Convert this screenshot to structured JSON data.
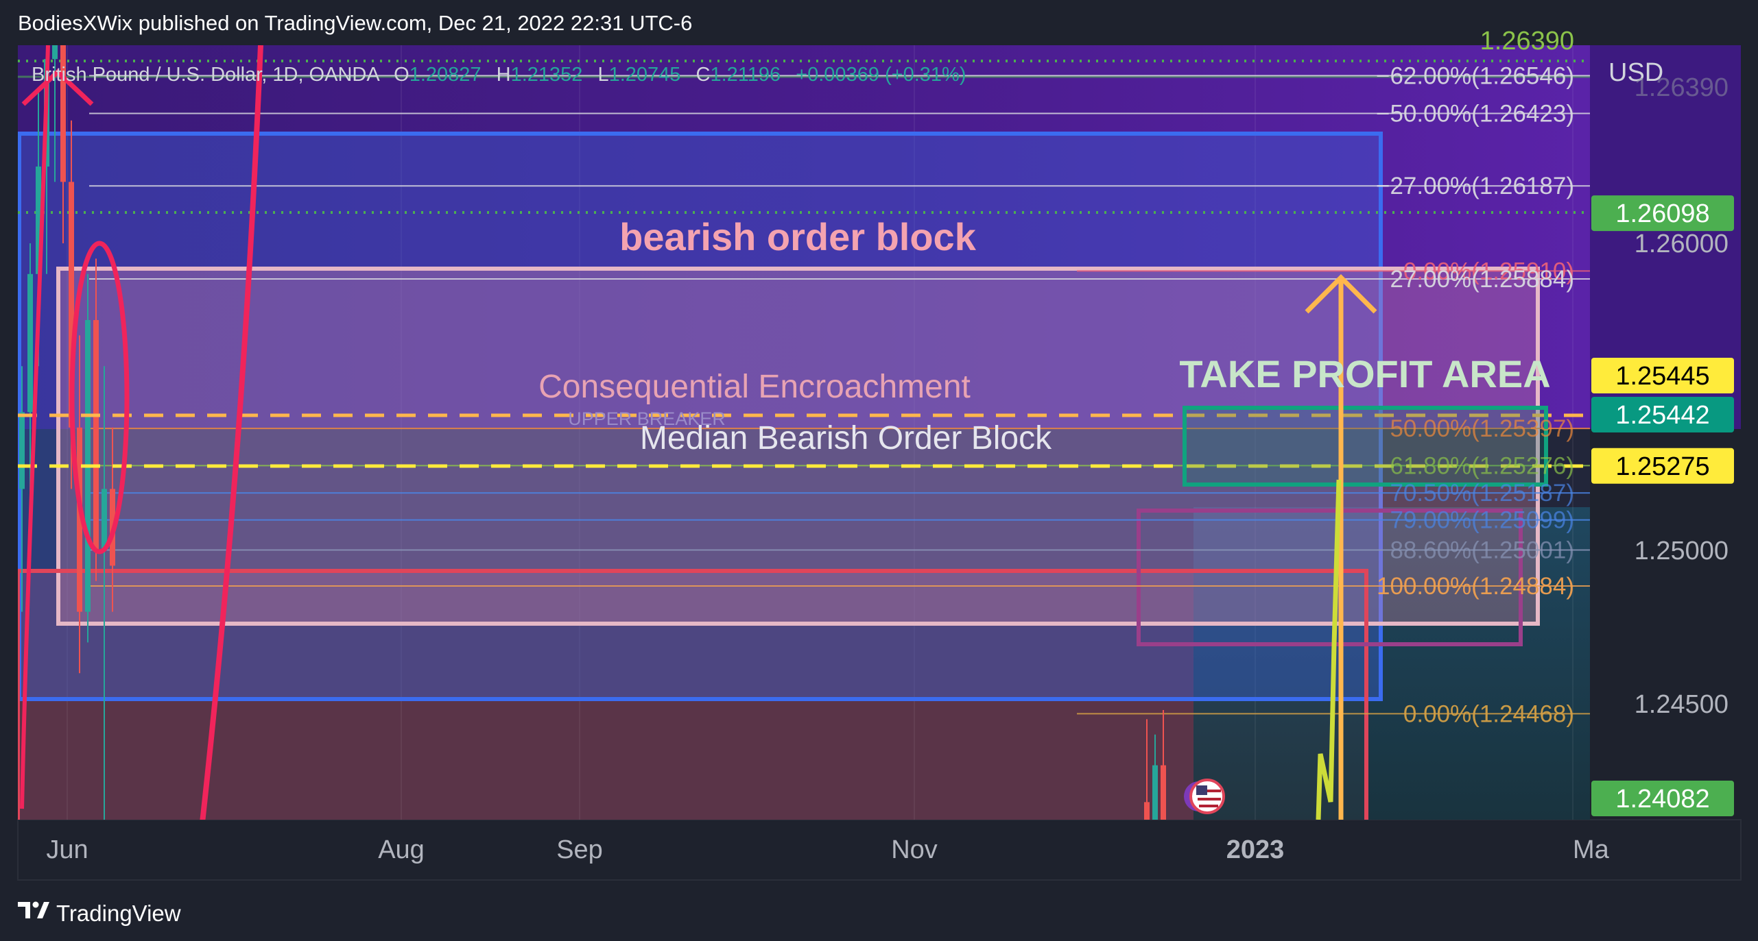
{
  "header": {
    "publish_line": "BodiesXWix published on TradingView.com, Dec 21, 2022 22:31 UTC-6"
  },
  "footer": {
    "brand": "TradingView"
  },
  "symbol": {
    "name": "British Pound / U.S. Dollar, 1D, OANDA",
    "o_label": "O",
    "o": "1.20827",
    "h_label": "H",
    "h": "1.21352",
    "l_label": "L",
    "l": "1.20745",
    "c_label": "C",
    "c": "1.21196",
    "change": "+0.00369 (+0.31%)"
  },
  "colors": {
    "background": "#1e222d",
    "purple_zone": "#5a1f9a",
    "blue_box": "#2f55c9",
    "order_block": "#c77a9b",
    "green_badge": "#4caf50",
    "yellow_badge": "#ffeb3b",
    "teal_badge": "#089981",
    "orange_dash": "#ffb74d",
    "tp_box": "#10a37f",
    "red_circle": "#f0245b"
  },
  "chart_data": {
    "type": "candlestick",
    "price_axis_unit": "USD",
    "y_range": [
      1.238,
      1.273
    ],
    "y_ticks": [
      "1.26000",
      "1.25000",
      "1.24500"
    ],
    "x_ticks": [
      "Jun",
      "Aug",
      "Sep",
      "Nov",
      "2023",
      "Ma"
    ],
    "annotations": {
      "bearish_order_block": "bearish order block",
      "consequential_encroachment": "Consequential Encroachment",
      "upper_breaker": "UPPER BREAKER",
      "median_block": "Median Bearish Order Block",
      "take_profit": "TAKE PROFIT AREA",
      "top_cut_label": "1.26390"
    },
    "fib_levels": [
      {
        "label": "−62.00%(1.26546)",
        "price": 1.26546,
        "color": "#d8d8e0"
      },
      {
        "label": "−50.00%(1.26423)",
        "price": 1.26423,
        "color": "#d8d8e0"
      },
      {
        "label": "−27.00%(1.26187)",
        "price": 1.26187,
        "color": "#d8d8e0"
      },
      {
        "label": "0.00%(1.25910)",
        "price": 1.2591,
        "color": "#e8607a"
      },
      {
        "label": "27.00%(1.25884)",
        "price": 1.25884,
        "color": "#d8d8e0"
      },
      {
        "label": "50.00%(1.25397)",
        "price": 1.25397,
        "color": "#f08a3a"
      },
      {
        "label": "61.80%(1.25276)",
        "price": 1.25276,
        "color": "#8bc34a"
      },
      {
        "label": "70.50%(1.25187)",
        "price": 1.25187,
        "color": "#4a86e8"
      },
      {
        "label": "79.00%(1.25099)",
        "price": 1.25099,
        "color": "#4a86e8"
      },
      {
        "label": "88.60%(1.25001)",
        "price": 1.25001,
        "color": "#8a96b8"
      },
      {
        "label": "100.00%(1.24884)",
        "price": 1.24884,
        "color": "#f0a050"
      },
      {
        "label": "0.00%(1.24468)",
        "price": 1.24468,
        "color": "#d4a045"
      }
    ],
    "price_badges": [
      {
        "label": "1.26098",
        "price": 1.26098,
        "bg": "#4caf50",
        "fg": "#ffffff"
      },
      {
        "label": "1.25445",
        "price": 1.25445,
        "bg": "#ffeb3b",
        "fg": "#000000"
      },
      {
        "label": "1.25442",
        "price": 1.25442,
        "bg": "#089981",
        "fg": "#ffffff"
      },
      {
        "label": "1.25275",
        "price": 1.25275,
        "bg": "#ffeb3b",
        "fg": "#000000"
      },
      {
        "label": "1.24082",
        "price": 1.24082,
        "bg": "#4caf50",
        "fg": "#ffffff"
      }
    ],
    "candles": [
      {
        "o": 1.252,
        "h": 1.256,
        "l": 1.248,
        "c": 1.2545
      },
      {
        "o": 1.2545,
        "h": 1.26,
        "l": 1.25,
        "c": 1.259
      },
      {
        "o": 1.259,
        "h": 1.265,
        "l": 1.256,
        "c": 1.2625
      },
      {
        "o": 1.2625,
        "h": 1.269,
        "l": 1.259,
        "c": 1.266
      },
      {
        "o": 1.266,
        "h": 1.272,
        "l": 1.262,
        "c": 1.269
      },
      {
        "o": 1.269,
        "h": 1.271,
        "l": 1.26,
        "c": 1.262
      },
      {
        "o": 1.262,
        "h": 1.264,
        "l": 1.252,
        "c": 1.254
      },
      {
        "o": 1.254,
        "h": 1.257,
        "l": 1.246,
        "c": 1.248
      },
      {
        "o": 1.248,
        "h": 1.259,
        "l": 1.247,
        "c": 1.2575
      },
      {
        "o": 1.2575,
        "h": 1.2595,
        "l": 1.249,
        "c": 1.25
      },
      {
        "o": 1.25,
        "h": 1.256,
        "l": 1.238,
        "c": 1.252
      },
      {
        "o": 1.252,
        "h": 1.254,
        "l": 1.248,
        "c": 1.2495
      }
    ],
    "recent_candles": [
      {
        "o": 1.2418,
        "h": 1.2445,
        "l": 1.238,
        "c": 1.239
      },
      {
        "o": 1.2395,
        "h": 1.244,
        "l": 1.238,
        "c": 1.243
      },
      {
        "o": 1.243,
        "h": 1.2448,
        "l": 1.24,
        "c": 1.2412
      }
    ]
  }
}
